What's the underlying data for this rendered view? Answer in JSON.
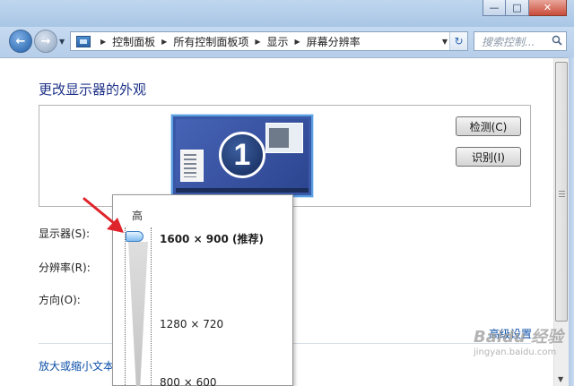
{
  "window": {
    "minimize": "—",
    "maximize": "□",
    "close": "✕"
  },
  "address_bar": {
    "breadcrumbs": [
      "控制面板",
      "所有控制面板项",
      "显示",
      "屏幕分辨率"
    ]
  },
  "search": {
    "placeholder": "搜索控制..."
  },
  "page": {
    "heading": "更改显示器的外观",
    "monitor_number": "1",
    "detect_button": "检测(C)",
    "identify_button": "识别(I)",
    "display_label": "显示器(S):",
    "resolution_label": "分辨率(R):",
    "orientation_label": "方向(O):",
    "advanced_link": "高级设置",
    "zoom_link": "放大或缩小文本"
  },
  "resolution_dropdown": {
    "high_label": "高",
    "options": [
      "1600 × 900 (推荐)",
      "1280 × 720",
      "800 × 600"
    ],
    "selected": "1600 × 900 (推荐)"
  },
  "watermark": {
    "main": "Baidu 经验",
    "sub": "jingyan.baidu.com"
  },
  "colors": {
    "link": "#0b4fa8",
    "heading": "#1e3287",
    "annotation_arrow": "#e0242b"
  }
}
